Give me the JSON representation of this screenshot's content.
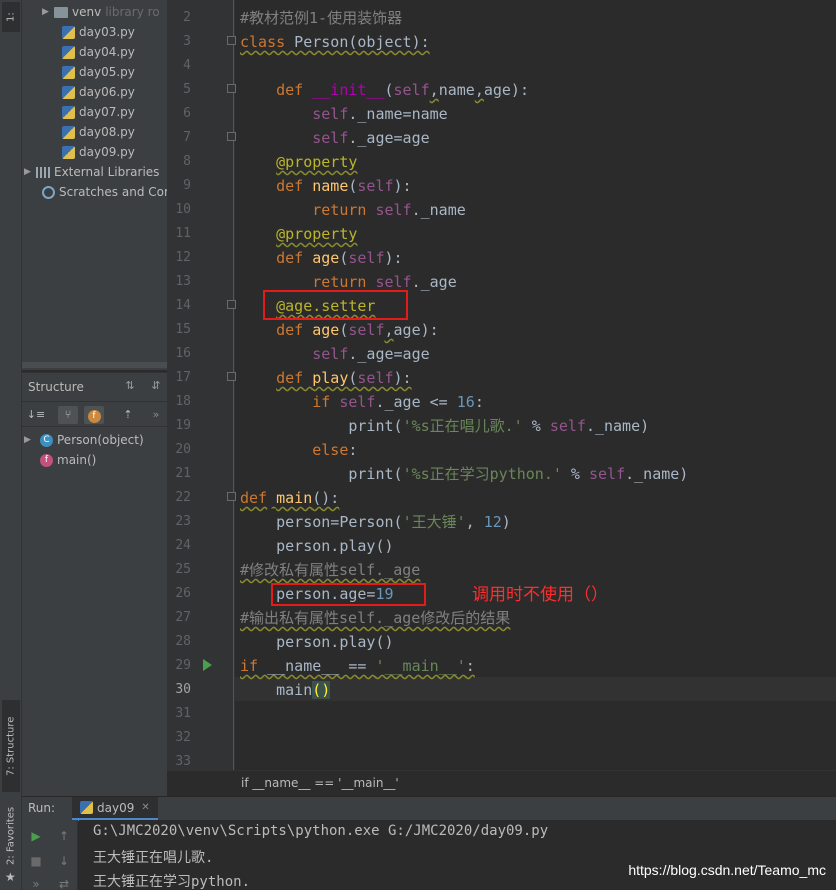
{
  "left_strip": {
    "project_tab": "1:",
    "structure_tab": "7: Structure",
    "favorites_tab": "2: Favorites"
  },
  "project": {
    "items": [
      {
        "label": "venv",
        "hint": "library ro",
        "type": "folder"
      },
      {
        "label": "day03.py",
        "type": "py"
      },
      {
        "label": "day04.py",
        "type": "py"
      },
      {
        "label": "day05.py",
        "type": "py"
      },
      {
        "label": "day06.py",
        "type": "py"
      },
      {
        "label": "day07.py",
        "type": "py"
      },
      {
        "label": "day08.py",
        "type": "py"
      },
      {
        "label": "day09.py",
        "type": "py"
      },
      {
        "label": "External Libraries",
        "type": "lib"
      },
      {
        "label": "Scratches and Cor",
        "type": "scratch"
      }
    ]
  },
  "structure": {
    "title": "Structure",
    "items": [
      {
        "label": "Person(object)",
        "badge": "C"
      },
      {
        "label": "main()",
        "badge": "f"
      }
    ]
  },
  "editor": {
    "line_numbers": [
      "2",
      "3",
      "4",
      "5",
      "6",
      "7",
      "8",
      "9",
      "10",
      "11",
      "12",
      "13",
      "14",
      "15",
      "16",
      "17",
      "18",
      "19",
      "20",
      "21",
      "22",
      "23",
      "24",
      "25",
      "26",
      "27",
      "28",
      "29",
      "30",
      "31",
      "32",
      "33"
    ],
    "annotation": "调用时不使用（）"
  },
  "breadcrumb": "if __name__ == '__main__'",
  "run": {
    "label": "Run:",
    "tab": "day09",
    "console": [
      "G:\\JMC2020\\venv\\Scripts\\python.exe G:/JMC2020/day09.py",
      "王大锤正在唱儿歌.",
      "王大锤正在学习python."
    ]
  },
  "watermark": "https://blog.csdn.net/Teamo_mc",
  "colors": {
    "keyword": "#cc7832",
    "self": "#94558d",
    "string": "#6a8759",
    "number": "#6897bb",
    "comment": "#808080",
    "decorator": "#bbb529",
    "highlight_box": "#e41b1b"
  }
}
